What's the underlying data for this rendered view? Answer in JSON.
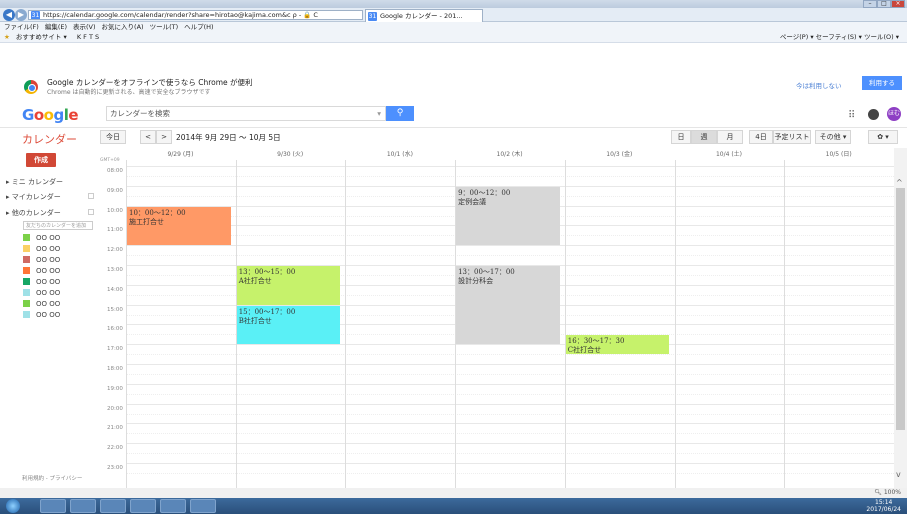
{
  "browser": {
    "url": "https://calendar.google.com/calendar/render?share=hirotao@kajima.com&c ρ - 🔒 C",
    "tab_title": "Google カレンダー - 201...",
    "menu": [
      "ファイル(F)",
      "編集(E)",
      "表示(V)",
      "お気に入り(A)",
      "ツール(T)",
      "ヘルプ(H)"
    ],
    "favorites": [
      "おすすめサイト ▾",
      "K F T S"
    ],
    "command_bar": "ページ(P) ▾  セーフティ(S) ▾  ツール(O) ▾",
    "zoom": "100%"
  },
  "promo": {
    "title": "Google カレンダーをオフラインで使うなら Chrome が便利",
    "subtitle": "Chrome は自動的に更新される、高速で安全なブラウザです",
    "dismiss": "今は利用しない",
    "use": "利用する"
  },
  "header": {
    "logo": "Google",
    "search_placeholder": "カレンダーを検索",
    "avatar": "ほむ"
  },
  "toolbar": {
    "app_title": "カレンダー",
    "today": "今日",
    "prev": "<",
    "next": ">",
    "range": "2014年 9月 29日 ～ 10月 5日",
    "views": [
      "日",
      "週",
      "月",
      "4日",
      "予定リスト",
      "その他 ▾"
    ],
    "selected_view": "週",
    "settings": "✿ ▾"
  },
  "sidebar": {
    "create": "作成",
    "sections": [
      "▸ ミニ カレンダー",
      "▸ マイカレンダー",
      "▸ 他のカレンダー"
    ],
    "add_calendar_placeholder": "友だちのカレンダーを追加",
    "calendars": [
      {
        "label": "OO  OO",
        "color": "#7bd148"
      },
      {
        "label": "OO  OO",
        "color": "#fad165"
      },
      {
        "label": "OO  OO",
        "color": "#d06b64"
      },
      {
        "label": "OO  OO",
        "color": "#ff7537"
      },
      {
        "label": "OO  OO",
        "color": "#16a765"
      },
      {
        "label": "OO  OO",
        "color": "#9fe1e7"
      },
      {
        "label": "OO  OO",
        "color": "#7bd148"
      },
      {
        "label": "OO  OO",
        "color": "#9fe1e7"
      }
    ],
    "footer": "利用規約 - プライバシー"
  },
  "calendar": {
    "gmt": "GMT+09",
    "days": [
      "9/29 (月)",
      "9/30 (火)",
      "10/1 (水)",
      "10/2 (木)",
      "10/3 (金)",
      "10/4 (土)",
      "10/5 (日)"
    ],
    "hours": [
      "08:00",
      "09:00",
      "10:00",
      "11:00",
      "12:00",
      "13:00",
      "14:00",
      "15:00",
      "16:00",
      "17:00",
      "18:00",
      "19:00",
      "20:00",
      "21:00",
      "22:00",
      "23:00"
    ],
    "events": [
      {
        "day": 0,
        "start": 10.0,
        "end": 12.0,
        "time": "10：00～12：00",
        "title": "施工打合せ",
        "color": "#ff9966"
      },
      {
        "day": 1,
        "start": 13.0,
        "end": 15.0,
        "time": "13：00～15：00",
        "title": "A社打合せ",
        "color": "#c6f26b"
      },
      {
        "day": 1,
        "start": 15.0,
        "end": 17.0,
        "time": "15：00～17：00",
        "title": "B社打合せ",
        "color": "#5af0f6"
      },
      {
        "day": 3,
        "start": 9.0,
        "end": 12.0,
        "time": "9：00～12：00",
        "title": "定例会議",
        "color": "#d7d7d7"
      },
      {
        "day": 3,
        "start": 13.0,
        "end": 17.0,
        "time": "13：00～17：00",
        "title": "設計分科会",
        "color": "#d7d7d7"
      },
      {
        "day": 4,
        "start": 16.5,
        "end": 17.5,
        "time": "16：30～17：30",
        "title": "C社打合せ",
        "color": "#c6f26b"
      }
    ]
  },
  "taskbar": {
    "time": "15:14",
    "date": "2017/06/24"
  }
}
